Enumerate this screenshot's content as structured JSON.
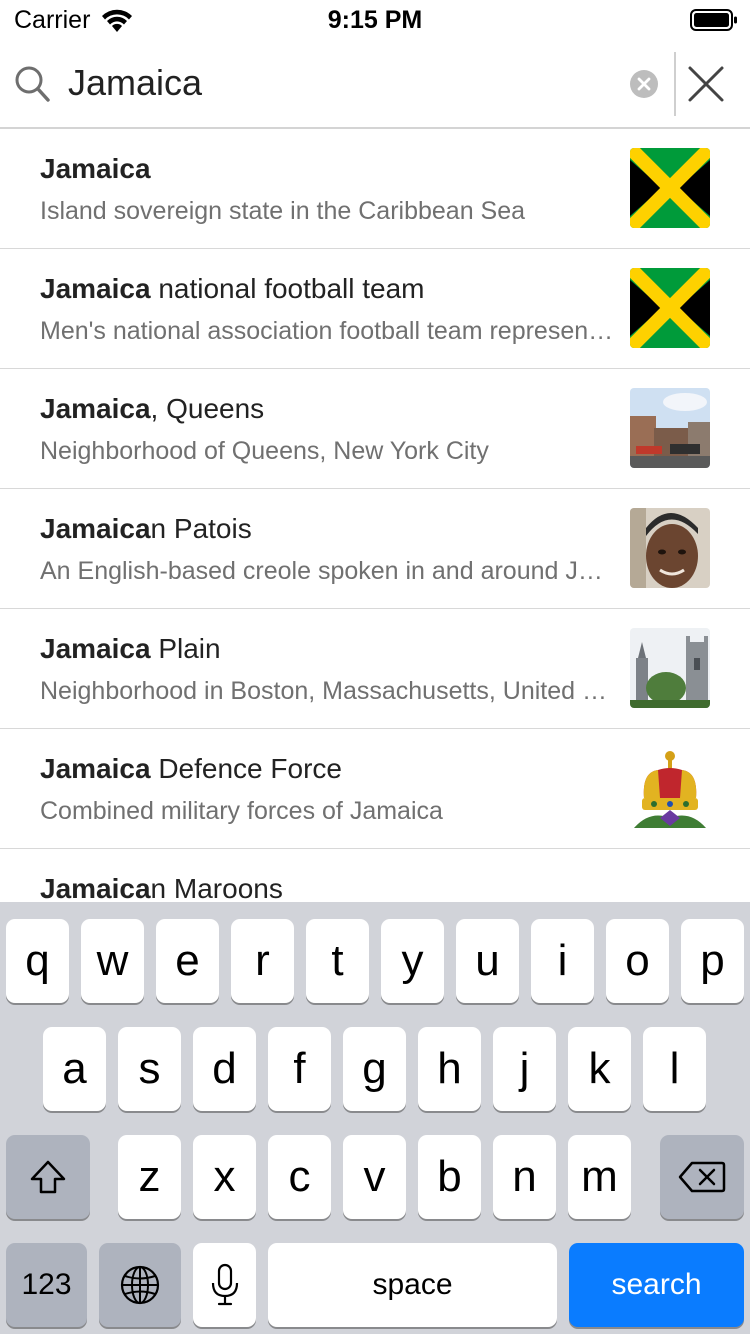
{
  "status_bar": {
    "carrier": "Carrier",
    "time": "9:15 PM",
    "icons": [
      "wifi-icon",
      "battery-icon"
    ]
  },
  "search": {
    "query": "Jamaica",
    "icons": [
      "search-icon",
      "clear-icon",
      "close-icon"
    ]
  },
  "results": [
    {
      "bold": "Jamaica",
      "rest": "",
      "description": "Island sovereign state in the Caribbean Sea",
      "thumbnail": "flag-jamaica"
    },
    {
      "bold": "Jamaica",
      "rest": " national football team",
      "description": "Men's national association football team representing Jamaica",
      "thumbnail": "flag-jamaica"
    },
    {
      "bold": "Jamaica",
      "rest": ", Queens",
      "description": "Neighborhood of Queens, New York City",
      "thumbnail": "street-photo"
    },
    {
      "bold": "Jamaica",
      "rest": "n Patois",
      "description": "An English-based creole spoken in and around Jamaica",
      "thumbnail": "portrait-photo"
    },
    {
      "bold": "Jamaica",
      "rest": " Plain",
      "description": "Neighborhood in Boston, Massachusetts, United States",
      "thumbnail": "church-photo"
    },
    {
      "bold": "Jamaica",
      "rest": " Defence Force",
      "description": "Combined military forces of Jamaica",
      "thumbnail": "crown-emblem"
    },
    {
      "bold": "Jamaica",
      "rest": "n Maroons",
      "description": "",
      "thumbnail": ""
    }
  ],
  "keyboard": {
    "row1": [
      "q",
      "w",
      "e",
      "r",
      "t",
      "y",
      "u",
      "i",
      "o",
      "p"
    ],
    "row2": [
      "a",
      "s",
      "d",
      "f",
      "g",
      "h",
      "j",
      "k",
      "l"
    ],
    "row3": [
      "z",
      "x",
      "c",
      "v",
      "b",
      "n",
      "m"
    ],
    "numbers_label": "123",
    "space_label": "space",
    "search_label": "search",
    "colors": {
      "background": "#d1d3d9",
      "key": "#ffffff",
      "dark_key": "#aeb3be",
      "accent": "#0a7cff"
    }
  }
}
